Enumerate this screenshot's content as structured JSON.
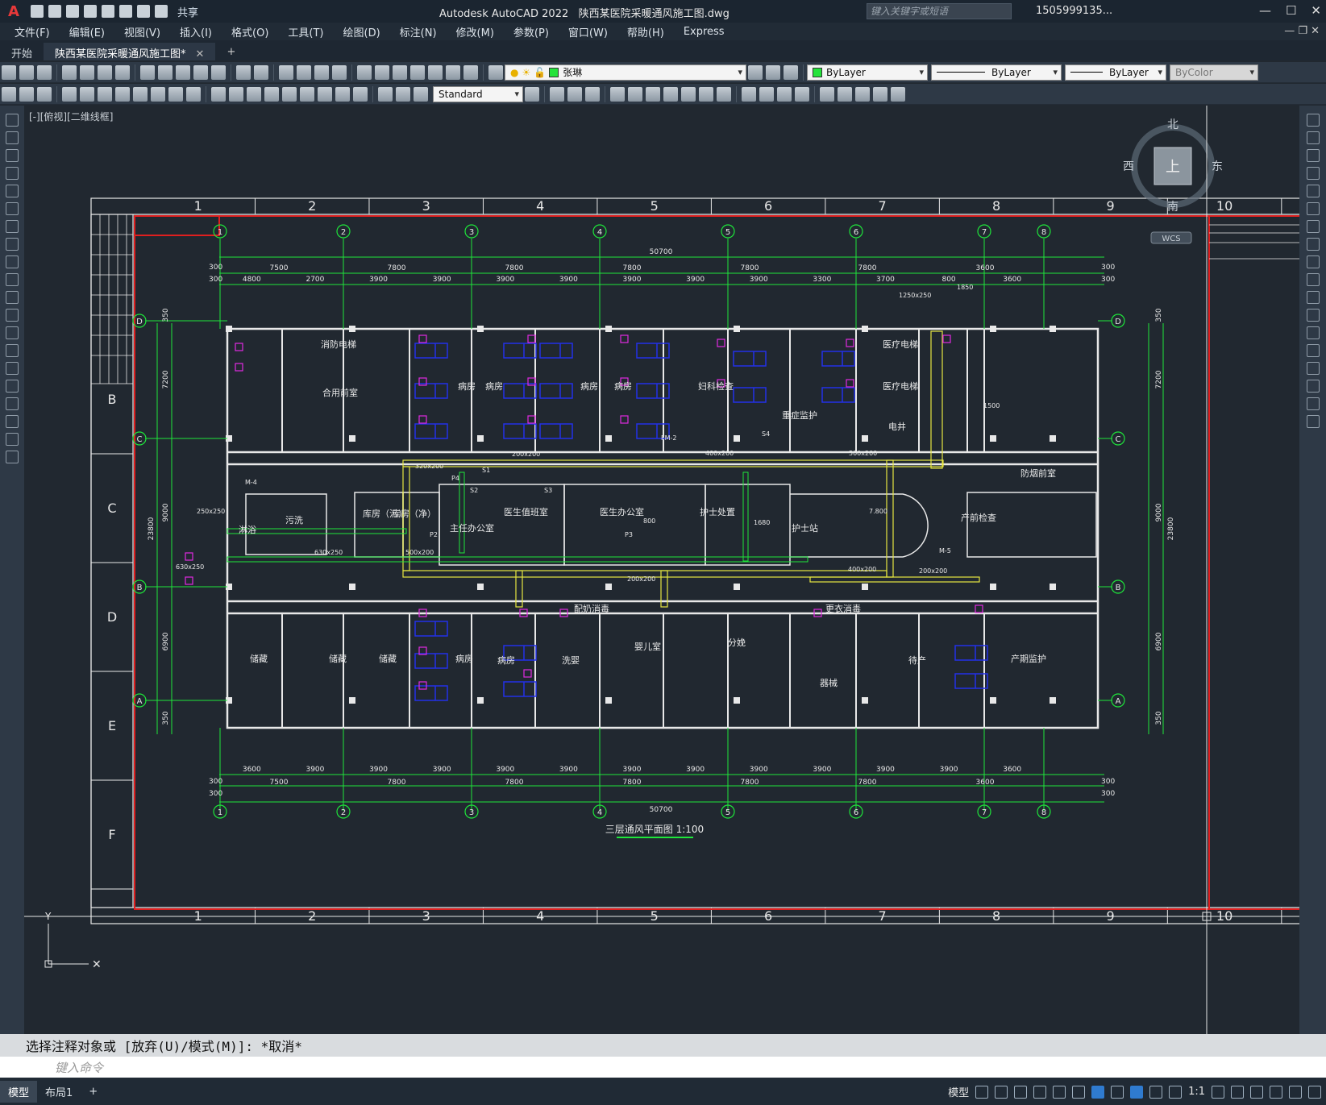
{
  "titlebar": {
    "app_title": "Autodesk AutoCAD 2022",
    "file_name": "陕西某医院采暖通风施工图.dwg",
    "share_label": "共享",
    "search_placeholder": "键入关键字或短语",
    "user": "1505999135..."
  },
  "menu": [
    "文件(F)",
    "编辑(E)",
    "视图(V)",
    "插入(I)",
    "格式(O)",
    "工具(T)",
    "绘图(D)",
    "标注(N)",
    "修改(M)",
    "参数(P)",
    "窗口(W)",
    "帮助(H)",
    "Express"
  ],
  "tabs": {
    "start": "开始",
    "doc": "陕西某医院采暖通风施工图*"
  },
  "toolbar": {
    "layer": "张琳",
    "color": "ByLayer",
    "linetype": "ByLayer",
    "lineweight": "ByLayer",
    "plotstyle": "ByColor",
    "textstyle": "Standard"
  },
  "viewport": {
    "label": "[-][俯视][二维线框]"
  },
  "viewcube": {
    "n": "北",
    "s": "南",
    "w": "西",
    "e": "东",
    "top": "上",
    "wcs": "WCS"
  },
  "drawing": {
    "title": "三层通风平面图 1:100",
    "frame_cols": [
      "1",
      "2",
      "3",
      "4",
      "5",
      "6",
      "7",
      "8",
      "9",
      "10"
    ],
    "frame_rows": [
      "B",
      "C",
      "D",
      "E",
      "F"
    ],
    "axes_x": [
      "1",
      "2",
      "3",
      "4",
      "5",
      "6",
      "7",
      "8"
    ],
    "axes_y": [
      "D",
      "C",
      "B",
      "A"
    ],
    "top_total": "50700",
    "top_row1": [
      "7500",
      "7800",
      "7800",
      "7800",
      "7800",
      "7800",
      "3600"
    ],
    "top_row2": [
      "4800",
      "2700",
      "3900",
      "3900",
      "3900",
      "3900",
      "3900",
      "3900",
      "3900",
      "3300",
      "3700",
      "800",
      "3600"
    ],
    "bottom_row1": [
      "3600",
      "3900",
      "3900",
      "3900",
      "3900",
      "3900",
      "3900",
      "3900",
      "3900",
      "3900",
      "3900",
      "3900",
      "3600"
    ],
    "bottom_row2": [
      "7500",
      "7800",
      "7800",
      "7800",
      "7800",
      "7800",
      "3600"
    ],
    "bottom_total": "50700",
    "edge_300": "300",
    "side_dims": [
      "350",
      "7200",
      "9000",
      "6900",
      "350"
    ],
    "side_total": "23800",
    "rooms": [
      {
        "t": "消防电梯"
      },
      {
        "t": "合用前室"
      },
      {
        "t": "病房"
      },
      {
        "t": "病房"
      },
      {
        "t": "病房"
      },
      {
        "t": "病房"
      },
      {
        "t": "妇科检查"
      },
      {
        "t": "重症监护"
      },
      {
        "t": "医疗电梯"
      },
      {
        "t": "医疗电梯"
      },
      {
        "t": "电井"
      },
      {
        "t": "防烟前室"
      },
      {
        "t": "淋浴"
      },
      {
        "t": "污洗"
      },
      {
        "t": "库房（污）"
      },
      {
        "t": "库房（净）"
      },
      {
        "t": "主任办公室"
      },
      {
        "t": "医生值班室"
      },
      {
        "t": "医生办公室"
      },
      {
        "t": "护士处置"
      },
      {
        "t": "护士站"
      },
      {
        "t": "产前检查"
      },
      {
        "t": "储藏"
      },
      {
        "t": "储藏"
      },
      {
        "t": "储藏"
      },
      {
        "t": "病房"
      },
      {
        "t": "病房"
      },
      {
        "t": "配奶消毒"
      },
      {
        "t": "洗婴"
      },
      {
        "t": "婴儿室"
      },
      {
        "t": "分娩"
      },
      {
        "t": "更衣消毒"
      },
      {
        "t": "器械"
      },
      {
        "t": "待产"
      },
      {
        "t": "产期监护"
      }
    ],
    "duct_labels": [
      "200x200",
      "320x200",
      "400x200",
      "500x200",
      "630x250",
      "250x250",
      "630x250",
      "500x200",
      "200x200",
      "400x200",
      "200x200",
      "1250x250",
      "1850",
      "1500",
      "1680",
      "800",
      "7.800"
    ],
    "tags": [
      "S1",
      "S2",
      "S3",
      "S4",
      "P2",
      "P3",
      "P4",
      "M-4",
      "M-5",
      "FM-2"
    ]
  },
  "command": {
    "history": "选择注释对象或 [放弃(U)/模式(M)]: *取消*",
    "placeholder": "键入命令"
  },
  "status": {
    "model_tab": "模型",
    "layout_tab": "布局1",
    "add": "+",
    "model": "模型",
    "scale": "1:1"
  },
  "colors": {
    "frame_red": "#e01f1f",
    "axis_green": "#1ee63a",
    "wall_white": "#e8e8e8",
    "equip_blue": "#2330e8",
    "magenta": "#e02ae0",
    "duct_yellow": "#e6e640"
  }
}
